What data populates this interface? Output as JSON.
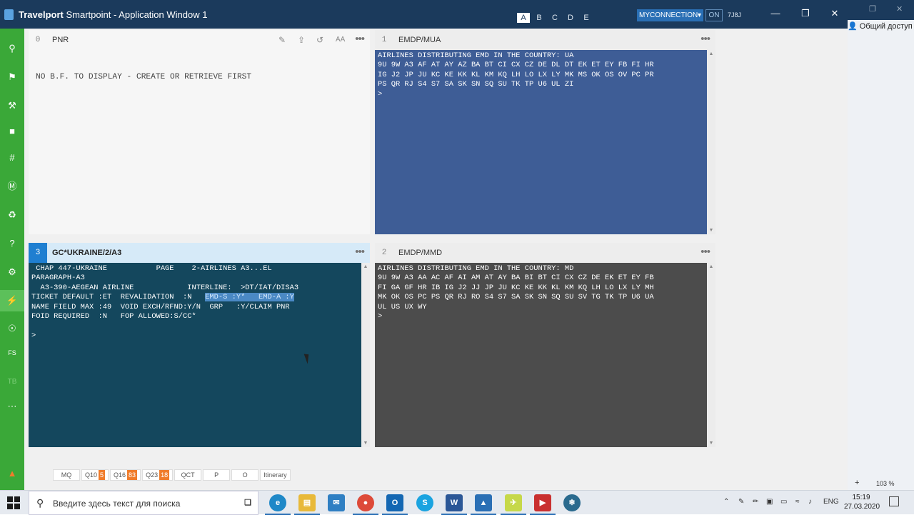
{
  "window": {
    "title_bold": "Travelport",
    "title_rest": " Smartpoint - Application Window 1",
    "workspace_tabs": [
      "A",
      "B",
      "C",
      "D",
      "E"
    ],
    "active_tab": "A",
    "connection": "MYCONNECTION",
    "connection_status": "ON",
    "pcc": "7J8J"
  },
  "right_window": {
    "share_label": "Общий доступ",
    "zoom": "103 %"
  },
  "sidebar": {
    "items": [
      "search-icon",
      "tag-icon",
      "wrench-icon",
      "square-icon",
      "hash-icon",
      "m-icon",
      "recycle-icon",
      "help-icon",
      "settings-icon",
      "plug-icon",
      "location-icon",
      "fs-icon",
      "tb-icon",
      "more-icon",
      "bell-icon"
    ]
  },
  "panels": {
    "p0": {
      "number": "0",
      "title": "PNR",
      "message": "NO B.F. TO DISPLAY - CREATE OR RETRIEVE FIRST"
    },
    "p1": {
      "number": "1",
      "title": "EMDP/MUA",
      "lines": [
        "AIRLINES DISTRIBUTING EMD IN THE COUNTRY: UA",
        "9U 9W A3 AF AT AY AZ BA BT CI CX CZ DE DL DT EK ET EY FB FI HR",
        "IG J2 JP JU KC KE KK KL KM KQ LH LO LX LY MK MS OK OS OV PC PR",
        "PS QR RJ S4 S7 SA SK SN SQ SU TK TP U6 UL ZI",
        ">"
      ]
    },
    "p3": {
      "number": "3",
      "title": "GC*UKRAINE/2/A3",
      "lines": [
        " CHAP 447-UKRAINE           PAGE    2-AIRLINES A3...EL",
        "PARAGRAPH-A3",
        "  A3-390-AEGEAN AIRLINE            INTERLINE:  >DT/IAT/DISA3",
        "TICKET DEFAULT :ET  REVALIDATION  :N   ",
        "NAME FIELD MAX :49  VOID EXCH/RFND:Y/N  GRP   :Y/CLAIM PNR",
        "FOID REQUIRED  :N   FOP ALLOWED:S/CC*",
        "",
        ">"
      ],
      "highlight": "EMD-S :Y*   EMD-A :Y"
    },
    "p2": {
      "number": "2",
      "title": "EMDP/MMD",
      "lines": [
        "AIRLINES DISTRIBUTING EMD IN THE COUNTRY: MD",
        "9U 9W A3 AA AC AF AI AM AT AY BA BI BT CI CX CZ DE EK ET EY FB",
        "FI GA GF HR IB IG J2 JJ JP JU KC KE KK KL KM KQ LH LO LX LY MH",
        "MK OK OS PC PS QR RJ RO S4 S7 SA SK SN SQ SU SV TG TK TP U6 UA",
        "UL US UX WY",
        ">"
      ]
    }
  },
  "queue_bar": [
    {
      "label": "MQ",
      "count": ""
    },
    {
      "label": "Q10",
      "count": "5"
    },
    {
      "label": "Q16",
      "count": "83"
    },
    {
      "label": "Q23",
      "count": "18"
    },
    {
      "label": "QCT",
      "count": ""
    },
    {
      "label": "P",
      "count": ""
    },
    {
      "label": "O",
      "count": ""
    },
    {
      "label": "Itinerary",
      "count": ""
    }
  ],
  "taskbar": {
    "search_placeholder": "Введите здесь текст для поиска",
    "language": "ENG",
    "time": "15:19",
    "date": "27.03.2020"
  }
}
